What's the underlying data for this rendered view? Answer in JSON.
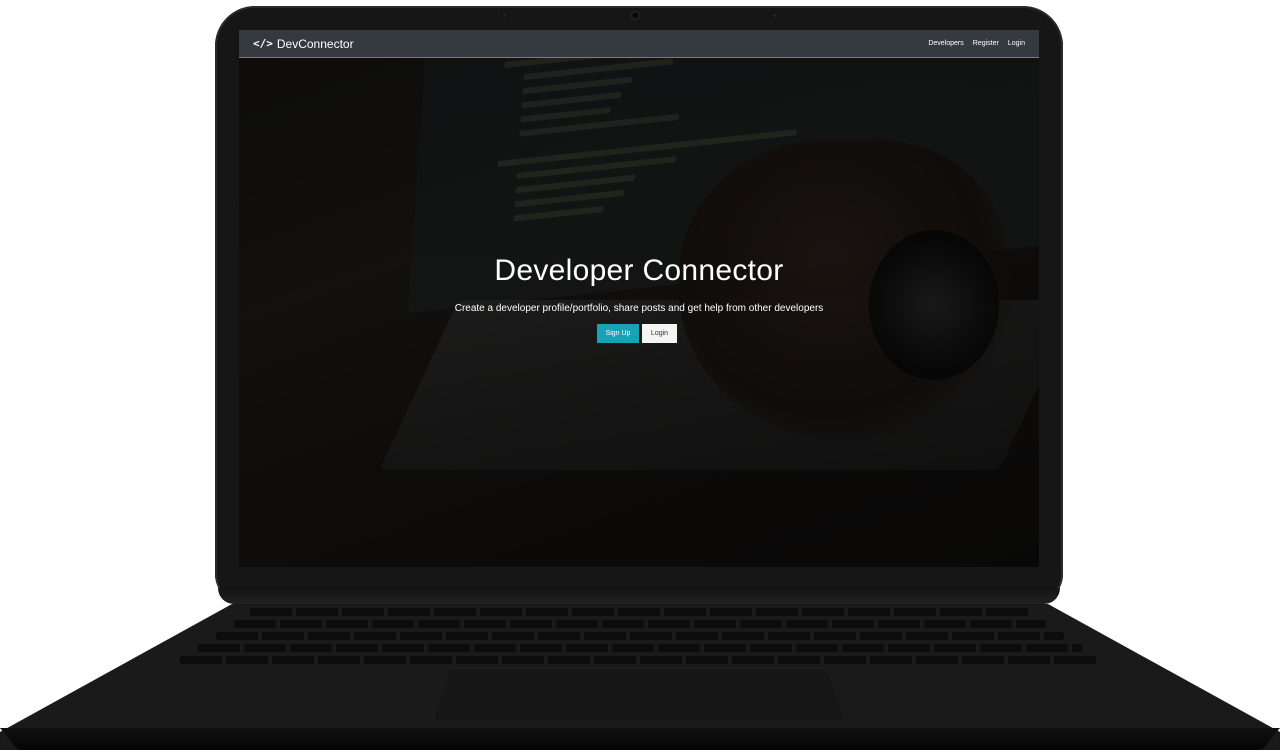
{
  "navbar": {
    "brand_label": "DevConnector",
    "brand_icon": "</>",
    "links": [
      "Developers",
      "Register",
      "Login"
    ]
  },
  "landing": {
    "title": "Developer Connector",
    "lead": "Create a developer profile/portfolio, share posts and get help from other developers",
    "signup_label": "Sign Up",
    "login_label": "Login"
  },
  "colors": {
    "accent": "#17a2b8",
    "navbar": "#343a40",
    "light_button": "#f4f4f4"
  }
}
